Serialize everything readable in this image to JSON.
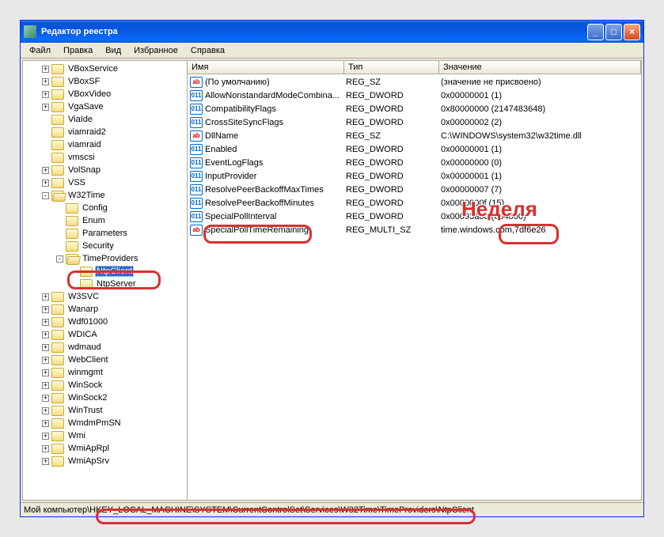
{
  "title": "Редактор реестра",
  "menu": [
    "Файл",
    "Правка",
    "Вид",
    "Избранное",
    "Справка"
  ],
  "wbtns": {
    "min": "_",
    "max": "□",
    "close": "×"
  },
  "tree": [
    {
      "d": 1,
      "e": "+",
      "l": "VBoxService"
    },
    {
      "d": 1,
      "e": "+",
      "l": "VBoxSF"
    },
    {
      "d": 1,
      "e": "+",
      "l": "VBoxVideo"
    },
    {
      "d": 1,
      "e": "+",
      "l": "VgaSave"
    },
    {
      "d": 1,
      "e": "",
      "l": "ViaIde"
    },
    {
      "d": 1,
      "e": "",
      "l": "viamraid2"
    },
    {
      "d": 1,
      "e": "",
      "l": "viamraid"
    },
    {
      "d": 1,
      "e": "",
      "l": "vmscsi"
    },
    {
      "d": 1,
      "e": "+",
      "l": "VolSnap"
    },
    {
      "d": 1,
      "e": "+",
      "l": "VSS"
    },
    {
      "d": 1,
      "e": "-",
      "l": "W32Time",
      "open": true
    },
    {
      "d": 2,
      "e": "",
      "l": "Config"
    },
    {
      "d": 2,
      "e": "",
      "l": "Enum"
    },
    {
      "d": 2,
      "e": "",
      "l": "Parameters"
    },
    {
      "d": 2,
      "e": "",
      "l": "Security"
    },
    {
      "d": 2,
      "e": "-",
      "l": "TimeProviders",
      "open": true
    },
    {
      "d": 3,
      "e": "",
      "l": "NtpClient",
      "sel": true
    },
    {
      "d": 3,
      "e": "",
      "l": "NtpServer"
    },
    {
      "d": 1,
      "e": "+",
      "l": "W3SVC"
    },
    {
      "d": 1,
      "e": "+",
      "l": "Wanarp"
    },
    {
      "d": 1,
      "e": "+",
      "l": "Wdf01000"
    },
    {
      "d": 1,
      "e": "+",
      "l": "WDICA"
    },
    {
      "d": 1,
      "e": "+",
      "l": "wdmaud"
    },
    {
      "d": 1,
      "e": "+",
      "l": "WebClient"
    },
    {
      "d": 1,
      "e": "+",
      "l": "winmgmt"
    },
    {
      "d": 1,
      "e": "+",
      "l": "WinSock"
    },
    {
      "d": 1,
      "e": "+",
      "l": "WinSock2"
    },
    {
      "d": 1,
      "e": "+",
      "l": "WinTrust"
    },
    {
      "d": 1,
      "e": "+",
      "l": "WmdmPmSN"
    },
    {
      "d": 1,
      "e": "+",
      "l": "Wmi"
    },
    {
      "d": 1,
      "e": "+",
      "l": "WmiApRpl"
    },
    {
      "d": 1,
      "e": "+",
      "l": "WmiApSrv"
    }
  ],
  "cols": {
    "name": "Имя",
    "type": "Тип",
    "value": "Значение"
  },
  "values": [
    {
      "i": "str",
      "n": "(По умолчанию)",
      "t": "REG_SZ",
      "v": "(значение не присвоено)"
    },
    {
      "i": "dw",
      "n": "AllowNonstandardModeCombina...",
      "t": "REG_DWORD",
      "v": "0x00000001 (1)"
    },
    {
      "i": "dw",
      "n": "CompatibilityFlags",
      "t": "REG_DWORD",
      "v": "0x80000000 (2147483648)"
    },
    {
      "i": "dw",
      "n": "CrossSiteSyncFlags",
      "t": "REG_DWORD",
      "v": "0x00000002 (2)"
    },
    {
      "i": "str",
      "n": "DllName",
      "t": "REG_SZ",
      "v": "C:\\WINDOWS\\system32\\w32time.dll"
    },
    {
      "i": "dw",
      "n": "Enabled",
      "t": "REG_DWORD",
      "v": "0x00000001 (1)"
    },
    {
      "i": "dw",
      "n": "EventLogFlags",
      "t": "REG_DWORD",
      "v": "0x00000000 (0)"
    },
    {
      "i": "dw",
      "n": "InputProvider",
      "t": "REG_DWORD",
      "v": "0x00000001 (1)"
    },
    {
      "i": "dw",
      "n": "ResolvePeerBackoffMaxTimes",
      "t": "REG_DWORD",
      "v": "0x00000007 (7)"
    },
    {
      "i": "dw",
      "n": "ResolvePeerBackoffMinutes",
      "t": "REG_DWORD",
      "v": "0x0000000f (15)"
    },
    {
      "i": "dw",
      "n": "SpecialPollInterval",
      "t": "REG_DWORD",
      "v": "0x00093a80 (604800)"
    },
    {
      "i": "str",
      "n": "SpecialPollTimeRemaining",
      "t": "REG_MULTI_SZ",
      "v": "time.windows.com,7df6e26"
    }
  ],
  "status_prefix": "Мой компьютер",
  "status_path": "\\HKEY_LOCAL_MACHINE\\SYSTEM\\CurrentControlSet\\Services\\W32Time\\TimeProviders\\NtpClient",
  "annotation": "Неделя",
  "icons": {
    "str": "ab",
    "dw": "011"
  }
}
